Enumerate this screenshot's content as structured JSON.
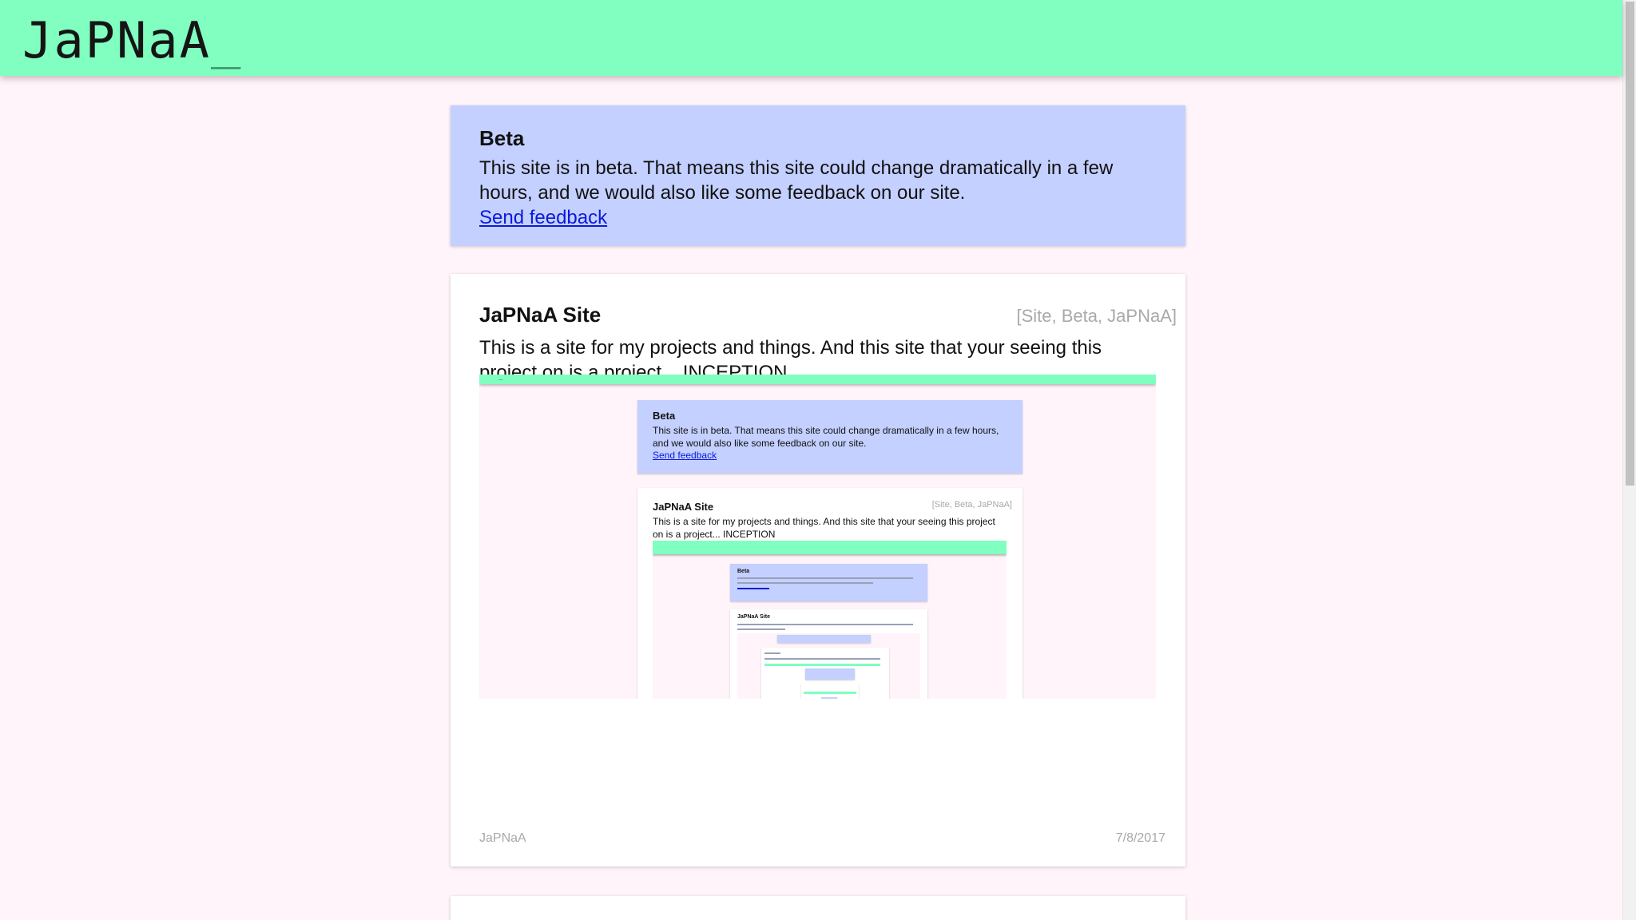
{
  "header": {
    "logo_text": "JaPNaA",
    "logo_cursor": "_"
  },
  "beta_notice": {
    "title": "Beta",
    "text": "This site is in beta. That means this site could change dramatically in a few hours, and we would also like some feedback on our site.",
    "link_label": "Send feedback"
  },
  "project": {
    "title": "JaPNaA Site",
    "tags": "[Site, Beta, JaPNaA]",
    "description": "This is a site for my projects and things. And this site that your seeing this project on is a project... INCEPTION",
    "author": "JaPNaA",
    "date": "7/8/2017"
  },
  "colors": {
    "header_bg": "#80ffc0",
    "page_bg": "#fff4f9",
    "beta_bg": "#c4d0ff",
    "link": "#0a1adb"
  }
}
